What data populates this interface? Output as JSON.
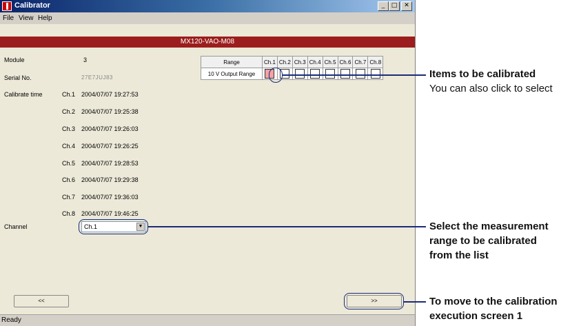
{
  "window": {
    "title": "Calibrator",
    "menu": [
      "File",
      "View",
      "Help"
    ],
    "banner": "MX120-VAO-M08"
  },
  "module": {
    "label": "Module",
    "value": "3"
  },
  "serial": {
    "label": "Serial No.",
    "value": "27E7JUJ83"
  },
  "calibrate_time": {
    "label": "Calibrate time",
    "rows": [
      {
        "ch": "Ch.1",
        "time": "2004/07/07 19:27:53"
      },
      {
        "ch": "Ch.2",
        "time": "2004/07/07 19:25:38"
      },
      {
        "ch": "Ch.3",
        "time": "2004/07/07 19:26:03"
      },
      {
        "ch": "Ch.4",
        "time": "2004/07/07 19:26:25"
      },
      {
        "ch": "Ch.5",
        "time": "2004/07/07 19:28:53"
      },
      {
        "ch": "Ch.6",
        "time": "2004/07/07 19:29:38"
      },
      {
        "ch": "Ch.7",
        "time": "2004/07/07 19:36:03"
      },
      {
        "ch": "Ch.8",
        "time": "2004/07/07 19:46:25"
      }
    ]
  },
  "range_table": {
    "header": "Range",
    "columns": [
      "Ch.1",
      "Ch.2",
      "Ch.3",
      "Ch.4",
      "Ch.5",
      "Ch.6",
      "Ch.7",
      "Ch.8"
    ],
    "row_label": "10 V Output Range",
    "selected": [
      true,
      false,
      false,
      false,
      false,
      false,
      false,
      false
    ]
  },
  "channel": {
    "label": "Channel",
    "value": "Ch.1"
  },
  "nav": {
    "prev": "<<",
    "next": ">>"
  },
  "status": "Ready",
  "annotations": {
    "items": {
      "line1": "Items to be calibrated",
      "line2": "You can also click to select"
    },
    "range": {
      "line1": "Select the measurement",
      "line2": "range to be calibrated",
      "line3": "from the list"
    },
    "next": {
      "line1": "To move to the calibration",
      "line2": "execution screen 1"
    }
  },
  "colors": {
    "banner": "#9c1d1d",
    "callout": "#1a2a7a",
    "selected_checkbox": "#f4a3a3"
  }
}
